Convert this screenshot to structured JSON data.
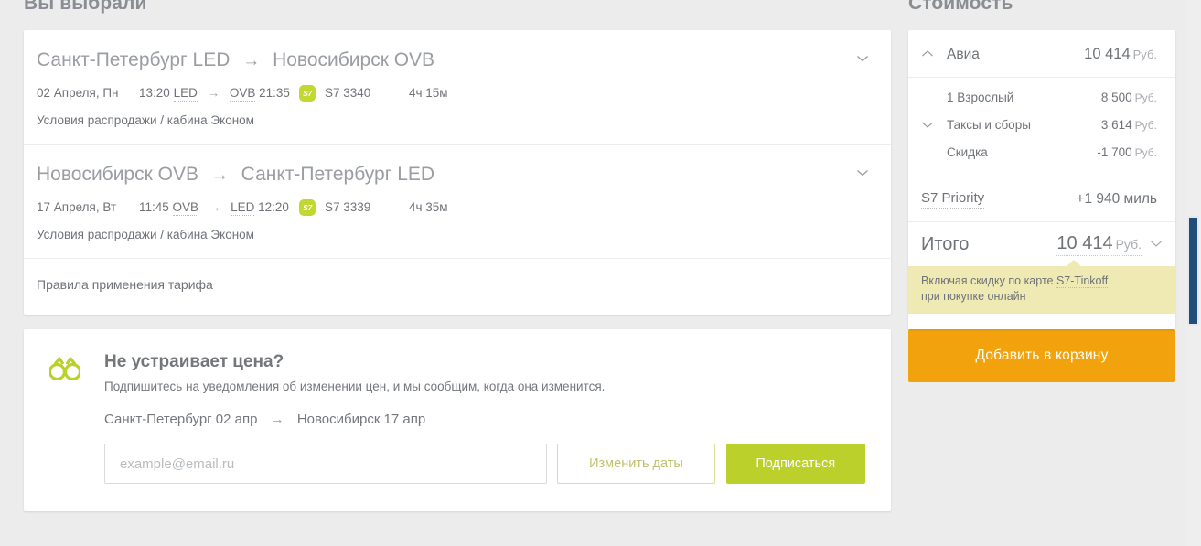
{
  "headings": {
    "left": "Вы выбрали",
    "right": "Стоимость"
  },
  "flights": [
    {
      "route_from": "Санкт-Петербург LED",
      "arrow": "→",
      "route_to": "Новосибирск OVB",
      "date": "02 Апреля, Пн",
      "dep_time": "13:20",
      "dep_code": "LED",
      "leg_arrow": "→",
      "arr_code": "OVB",
      "arr_time": "21:35",
      "carrier_icon": "s7-logo-icon",
      "flight_no": "S7 3340",
      "duration": "4ч 15м",
      "fare": "Условия распродажи / кабина Эконом",
      "expand_icon": "chevron-down-icon"
    },
    {
      "route_from": "Новосибирск OVB",
      "arrow": "→",
      "route_to": "Санкт-Петербург LED",
      "date": "17 Апреля, Вт",
      "dep_time": "11:45",
      "dep_code": "OVB",
      "leg_arrow": "→",
      "arr_code": "LED",
      "arr_time": "12:20",
      "carrier_icon": "s7-logo-icon",
      "flight_no": "S7 3339",
      "duration": "4ч 35м",
      "fare": "Условия распродажи / кабина Эконом",
      "expand_icon": "chevron-down-icon"
    }
  ],
  "rules_link": "Правила применения тарифа",
  "subscribe": {
    "icon": "binoculars-icon",
    "title": "Не устраивает цена?",
    "description": "Подпишитесь на уведомления об изменении цен, и мы сообщим, когда она изменится.",
    "route_from": "Санкт-Петербург 02 апр",
    "route_arrow": "→",
    "route_to": "Новосибирск 17 апр",
    "email_placeholder": "example@email.ru",
    "email_value": "",
    "change_dates_label": "Изменить даты",
    "subscribe_label": "Подписаться"
  },
  "price": {
    "avia": {
      "icon": "chevron-up-icon",
      "label": "Авиа",
      "amount": "10 414",
      "currency": "Руб."
    },
    "details": [
      {
        "label": "1 Взрослый",
        "amount": "8 500",
        "currency": "Руб.",
        "icon": ""
      },
      {
        "label": "Таксы и сборы",
        "amount": "3 614",
        "currency": "Руб.",
        "icon": "chevron-down-icon"
      },
      {
        "label": "Скидка",
        "amount": "-1 700",
        "currency": "Руб.",
        "icon": ""
      }
    ],
    "priority": {
      "label": "S7 Priority",
      "value": "+1 940 миль"
    },
    "total": {
      "label": "Итого",
      "amount": "10 414",
      "currency": "Руб.",
      "icon": "chevron-down-icon"
    },
    "tooltip": {
      "line1_pre": "Включая скидку по карте ",
      "line1_link": "S7-Tinkoff",
      "line2": "при покупке онлайн"
    },
    "cart_button": "Добавить в корзину"
  },
  "colors": {
    "brand_green": "#bcd02b",
    "s7_badge": "#c2d72f",
    "cart_orange": "#f2a20c",
    "tooltip_yellow": "#efeab4",
    "text_gray": "#6f7378",
    "page_bg": "#ececec",
    "scrollbar_thumb": "#1f4e79"
  }
}
